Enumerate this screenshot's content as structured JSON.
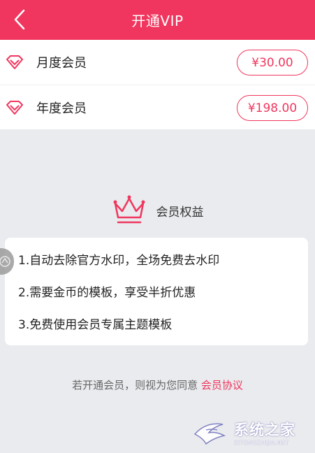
{
  "header": {
    "title": "开通VIP",
    "back_icon": "chevron-left-icon"
  },
  "plans": [
    {
      "name": "月度会员",
      "price": "¥30.00",
      "icon": "diamond-icon"
    },
    {
      "name": "年度会员",
      "price": "¥198.00",
      "icon": "diamond-icon"
    }
  ],
  "benefits": {
    "title": "会员权益",
    "icon": "crown-icon",
    "items": [
      "1.自动去除官方水印，全场免费去水印",
      "2.需要金币的模板，享受半折优惠",
      "3.免费使用会员专属主题模板"
    ]
  },
  "agreement": {
    "text": "若开通会员，则视为您同意 ",
    "link": "会员协议"
  },
  "watermark": {
    "cn": "系统之家",
    "en": "XITONGZHIJIA.NET"
  },
  "colors": {
    "accent": "#f0365e",
    "background": "#e9ebee",
    "card": "#ffffff"
  }
}
